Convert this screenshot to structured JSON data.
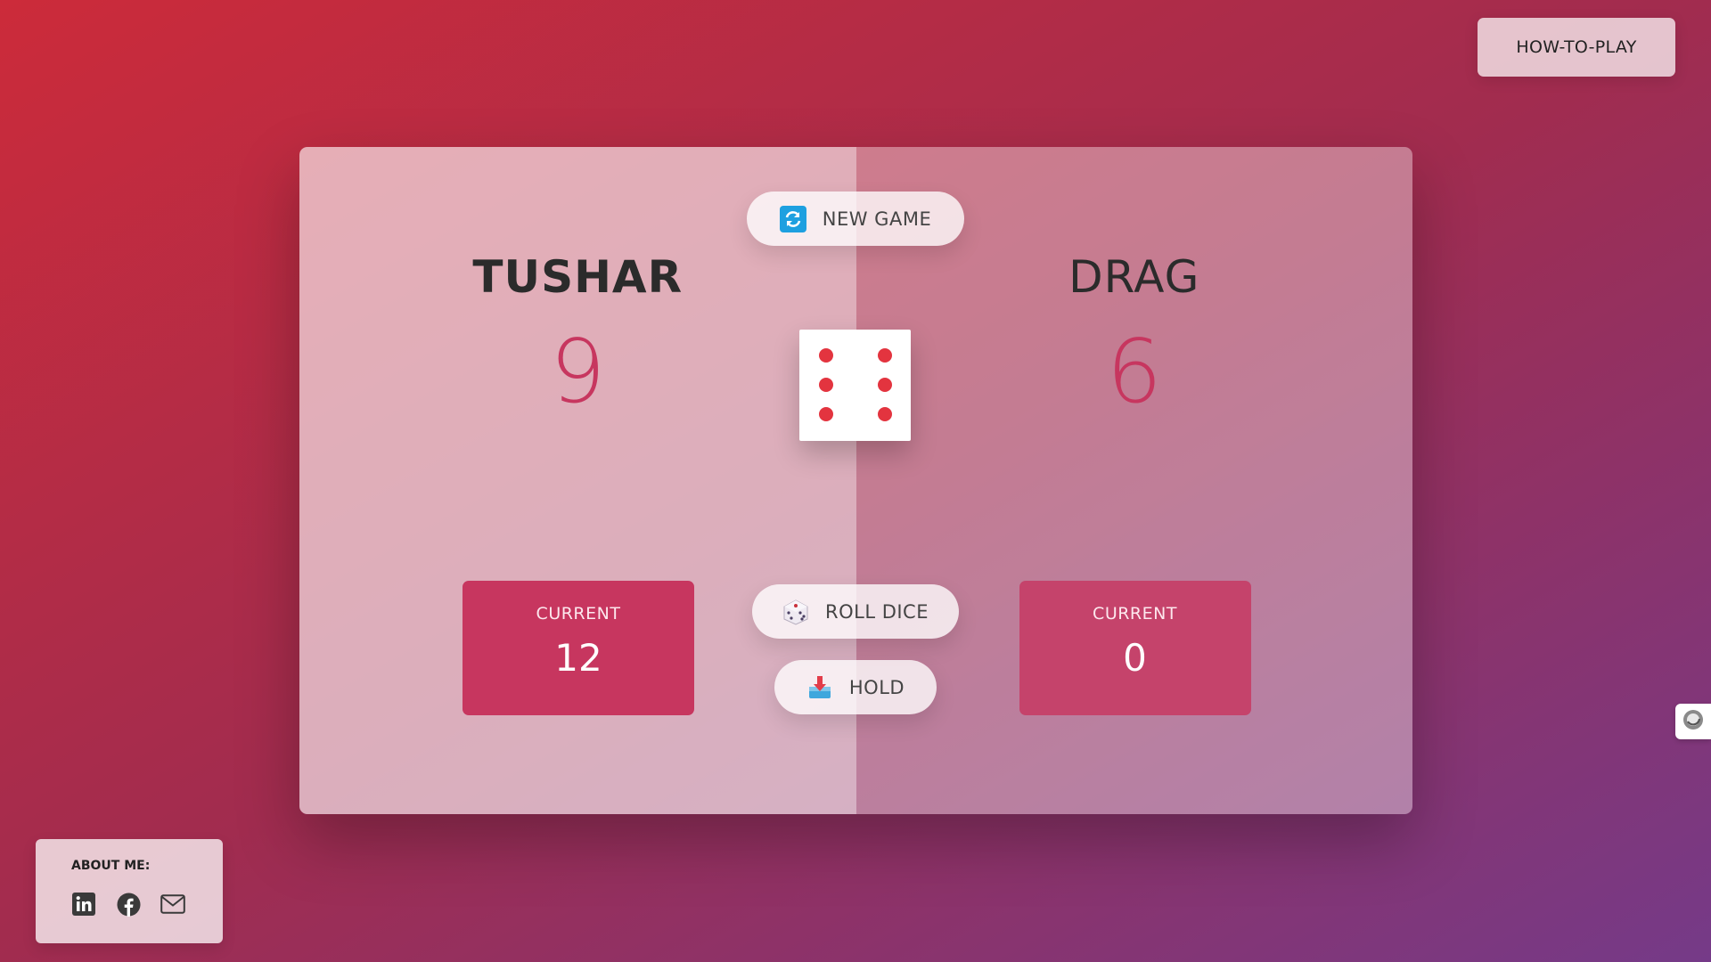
{
  "header": {
    "how_to_play_label": "HOW-TO-PLAY"
  },
  "players": [
    {
      "name": "TUSHAR",
      "score": "9",
      "current_label": "CURRENT",
      "current_score": "12",
      "active": true
    },
    {
      "name": "DRAG",
      "score": "6",
      "current_label": "CURRENT",
      "current_score": "0",
      "active": false
    }
  ],
  "controls": {
    "new_game_label": "NEW GAME",
    "roll_dice_label": "ROLL DICE",
    "hold_label": "HOLD"
  },
  "dice": {
    "value": 6
  },
  "about": {
    "title": "ABOUT ME:",
    "links": [
      "linkedin-icon",
      "facebook-icon",
      "mail-icon"
    ]
  },
  "colors": {
    "accent": "#c7365f",
    "dice_pip": "#e3343f",
    "new_game_icon": "#1ea0e0"
  }
}
